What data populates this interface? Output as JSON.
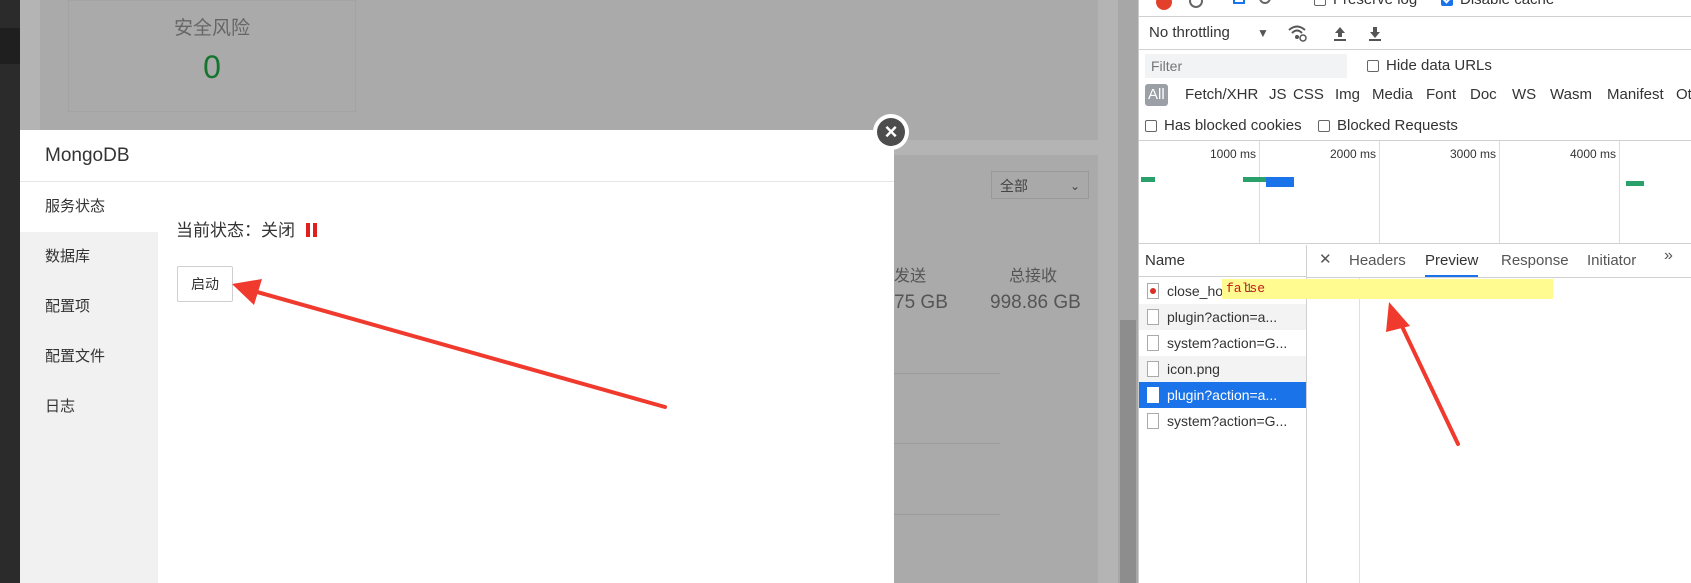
{
  "app": {
    "risk": {
      "label": "安全风险",
      "value": "0"
    },
    "filter_select": "全部",
    "stats": {
      "send_label": "发送",
      "send_value": "75 GB",
      "recv_label": "总接收",
      "recv_value": "998.86 GB"
    }
  },
  "modal": {
    "title": "MongoDB",
    "sidebar": [
      {
        "label": "服务状态",
        "active": true
      },
      {
        "label": "数据库",
        "active": false
      },
      {
        "label": "配置项",
        "active": false
      },
      {
        "label": "配置文件",
        "active": false
      },
      {
        "label": "日志",
        "active": false
      }
    ],
    "status_label": "当前状态：关闭",
    "status_color": "#e02020",
    "start_button": "启动",
    "close_icon": "close-icon"
  },
  "devtools": {
    "preserve_log": "Preserve log",
    "disable_cache": "Disable cache",
    "throttling": "No throttling",
    "filter_placeholder": "Filter",
    "hide_data_urls": "Hide data URLs",
    "types": [
      "All",
      "Fetch/XHR",
      "JS",
      "CSS",
      "Img",
      "Media",
      "Font",
      "Doc",
      "WS",
      "Wasm",
      "Manifest",
      "Other"
    ],
    "has_blocked_cookies": "Has blocked cookies",
    "blocked_requests": "Blocked Requests",
    "timeline_ticks": [
      "1000 ms",
      "2000 ms",
      "3000 ms",
      "4000 ms"
    ],
    "name_header": "Name",
    "requests": [
      {
        "name": "close_hover.png",
        "selected": false
      },
      {
        "name": "plugin?action=a...",
        "selected": false
      },
      {
        "name": "system?action=G...",
        "selected": false
      },
      {
        "name": "icon.png",
        "selected": false
      },
      {
        "name": "plugin?action=a...",
        "selected": true
      },
      {
        "name": "system?action=G...",
        "selected": false
      }
    ],
    "detail_tabs": [
      "Headers",
      "Preview",
      "Response",
      "Initiator"
    ],
    "active_tab": "Preview",
    "preview": {
      "line": "1",
      "text": "false"
    },
    "accent": "#1a73e8"
  }
}
